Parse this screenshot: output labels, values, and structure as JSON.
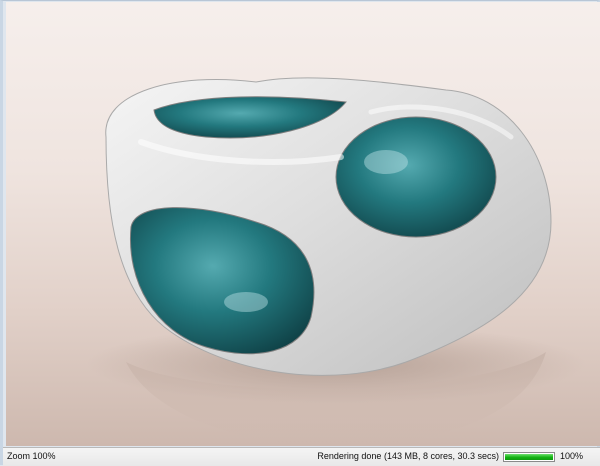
{
  "viewport": {
    "render_image_label": "render-output"
  },
  "statusbar": {
    "zoom_text": "Zoom 100%",
    "render_status": "Rendering done (143 MB, 8 cores, 30.3 secs)",
    "progress_value": 1.0,
    "progress_text": "100%"
  },
  "colors": {
    "progress_fill": "#12b212",
    "teal_surface": "#1f7b82",
    "white_shell": "#e2e2e2",
    "background": "#efe4df"
  }
}
